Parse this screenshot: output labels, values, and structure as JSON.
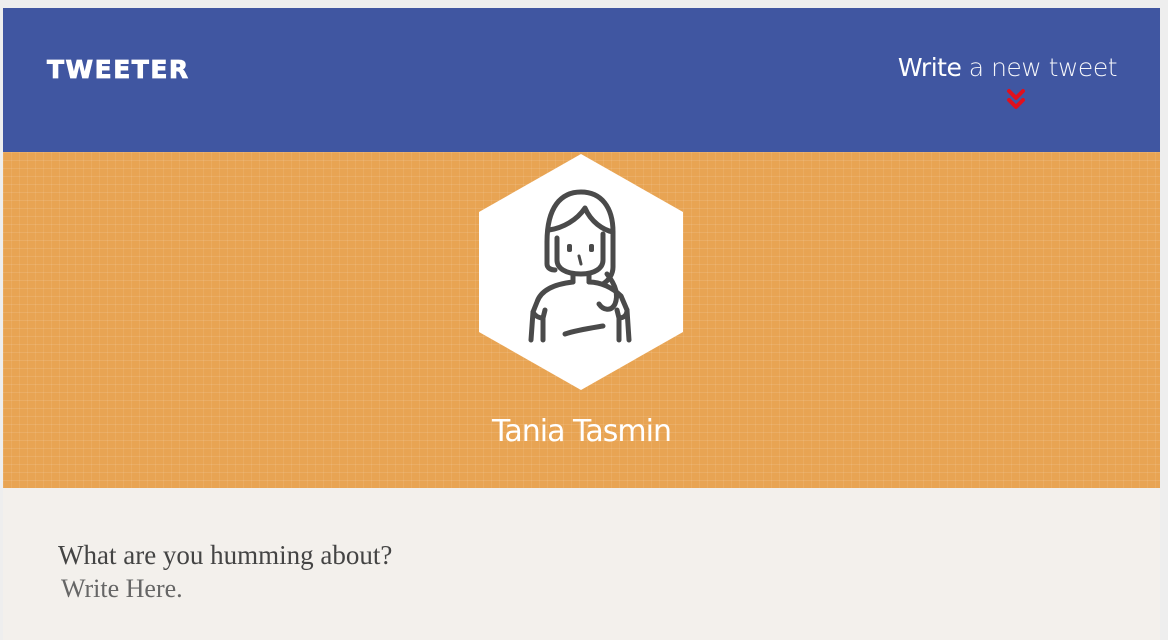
{
  "navbar": {
    "brand": "TWEETER",
    "compose": {
      "emphasis": "Write",
      "rest": "a new tweet",
      "icon": "double-chevron-down-icon",
      "icon_color": "#e0101d"
    },
    "background": "#4056a1"
  },
  "profile": {
    "name": "Tania Tasmin",
    "avatar_icon": "female-avatar-icon",
    "banner_color": "#e8a453"
  },
  "composer": {
    "label": "What are you humming about?",
    "placeholder": "Write Here.",
    "value": ""
  }
}
